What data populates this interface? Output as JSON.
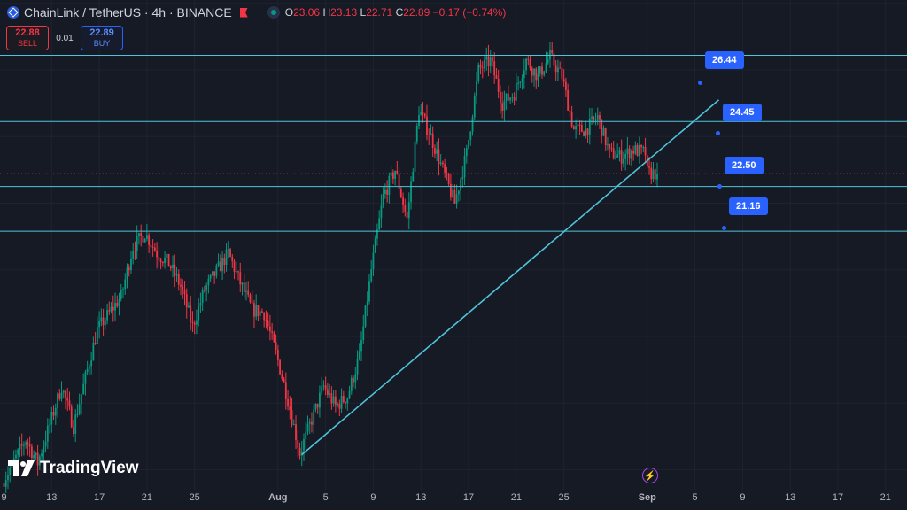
{
  "header": {
    "title": "ChainLink / TetherUS · 4h · BINANCE",
    "open_label": "O",
    "open": "23.06",
    "high_label": "H",
    "high": "23.13",
    "low_label": "L",
    "low": "22.71",
    "close_label": "C",
    "close": "22.89",
    "change": "−0.17 (−0.74%)"
  },
  "trade_panel": {
    "sell_price": "22.88",
    "sell_label": "SELL",
    "spread": "0.01",
    "buy_price": "22.89",
    "buy_label": "BUY"
  },
  "watermark": "TradingView",
  "icons": {
    "symbol": "chainlink-logo-icon",
    "flag": "flag-icon",
    "market_status": "market-open-dot-icon",
    "watermark": "tradingview-logo-icon",
    "lightning": "lightning-icon"
  },
  "colors": {
    "background": "#161a25",
    "up": "#089981",
    "down": "#f23645",
    "level_line": "#4fc3d9",
    "badge": "#2962ff"
  },
  "chart_data": {
    "type": "candlestick",
    "symbol": "ChainLink / TetherUS",
    "timeframe": "4h",
    "exchange": "BINANCE",
    "x_ticks": [
      "9",
      "13",
      "17",
      "21",
      "25",
      "Aug",
      "5",
      "9",
      "13",
      "17",
      "21",
      "25",
      "Sep",
      "5",
      "9",
      "13",
      "17",
      "21"
    ],
    "y_range": [
      13.4,
      28.1
    ],
    "price_path": [
      [
        "Jul 9",
        13.6
      ],
      [
        "Jul 11",
        14.9
      ],
      [
        "Jul 12",
        14.2
      ],
      [
        "Jul 14",
        16.5
      ],
      [
        "Jul 15",
        15.3
      ],
      [
        "Jul 17",
        18.2
      ],
      [
        "Jul 19",
        19.2
      ],
      [
        "Jul 20",
        20.7
      ],
      [
        "Jul 21",
        21.1
      ],
      [
        "Jul 22",
        20.5
      ],
      [
        "Jul 23",
        20.2
      ],
      [
        "Jul 24",
        19.5
      ],
      [
        "Jul 25",
        18.3
      ],
      [
        "Jul 26",
        19.4
      ],
      [
        "Jul 28",
        20.5
      ],
      [
        "Jul 29",
        19.6
      ],
      [
        "Jul 30",
        18.8
      ],
      [
        "Jul 31",
        18.7
      ],
      [
        "Aug 1",
        17.5
      ],
      [
        "Aug 2",
        16.1
      ],
      [
        "Aug 3",
        14.5
      ],
      [
        "Aug 5",
        16.5
      ],
      [
        "Aug 6",
        15.9
      ],
      [
        "Aug 7",
        16.2
      ],
      [
        "Aug 8",
        17.4
      ],
      [
        "Aug 9",
        20.0
      ],
      [
        "Aug 10",
        22.2
      ],
      [
        "Aug 11",
        23.0
      ],
      [
        "Aug 12",
        21.5
      ],
      [
        "Aug 13",
        24.8
      ],
      [
        "Aug 14",
        24.0
      ],
      [
        "Aug 15",
        23.0
      ],
      [
        "Aug 16",
        22.0
      ],
      [
        "Aug 17",
        23.5
      ],
      [
        "Aug 18",
        26.0
      ],
      [
        "Aug 19",
        26.3
      ],
      [
        "Aug 20",
        25.0
      ],
      [
        "Aug 21",
        25.3
      ],
      [
        "Aug 22",
        26.3
      ],
      [
        "Aug 23",
        25.8
      ],
      [
        "Aug 24",
        26.4
      ],
      [
        "Aug 25",
        25.8
      ],
      [
        "Aug 26",
        24.2
      ],
      [
        "Aug 27",
        24.2
      ],
      [
        "Aug 28",
        24.6
      ],
      [
        "Aug 29",
        23.5
      ],
      [
        "Aug 30",
        23.4
      ],
      [
        "Aug 31",
        23.6
      ],
      [
        "Sep 1",
        23.5
      ],
      [
        "Sep 1",
        22.9
      ]
    ],
    "last_close": 22.89,
    "horizontal_levels": [
      26.44,
      24.45,
      22.5,
      21.16
    ],
    "trendline": [
      [
        "Aug 3",
        14.45
      ],
      [
        "Sep 7",
        25.1
      ]
    ]
  }
}
